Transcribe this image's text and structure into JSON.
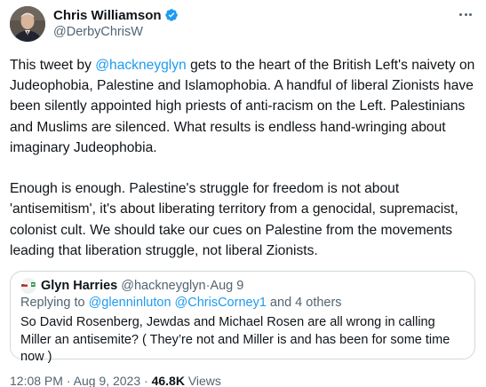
{
  "author": {
    "display_name": "Chris Williamson",
    "handle": "@DerbyChrisW"
  },
  "tweet": {
    "p1_before": "This tweet by ",
    "p1_mention": "@hackneyglyn",
    "p1_after": " gets to the heart of the British Left's naivety on Judeophobia, Palestine and Islamophobia. A handful of liberal Zionists have been silently appointed high priests of anti-racism on the Left. Palestinians and Muslims are silenced. What results is endless hand-wringing about imaginary Judeophobia.",
    "p2": "Enough is enough.  Palestine's struggle for freedom is not about 'antisemitism', it's about liberating territory from a genocidal, supremacist, colonist cult. We should take our cues on Palestine from the movements leading that liberation struggle, not liberal Zionists."
  },
  "quote": {
    "display_name": "Glyn Harries",
    "handle": "@hackneyglyn",
    "separator": " · ",
    "date": "Aug 9",
    "replying_prefix": "Replying to ",
    "replying_mentions": "@glenninluton @ChrisCorney1",
    "replying_suffix": " and 4 others",
    "text": "So David Rosenberg, Jewdas and Michael Rosen are all wrong in calling Miller an antisemite? ( They’re not and Miller is and has been for some time now )"
  },
  "footer": {
    "time": "12:08 PM",
    "separator": " · ",
    "date": "Aug 9, 2023",
    "views_count": "46.8K",
    "views_label": " Views"
  },
  "colors": {
    "link": "#1d9bf0",
    "secondary_text": "#536471",
    "border": "#cfd9de",
    "verified": "#1d9bf0"
  },
  "icons": {
    "verified": "verified-badge-icon",
    "more": "more-options-icon",
    "flags": "flags-emoji-icon"
  }
}
